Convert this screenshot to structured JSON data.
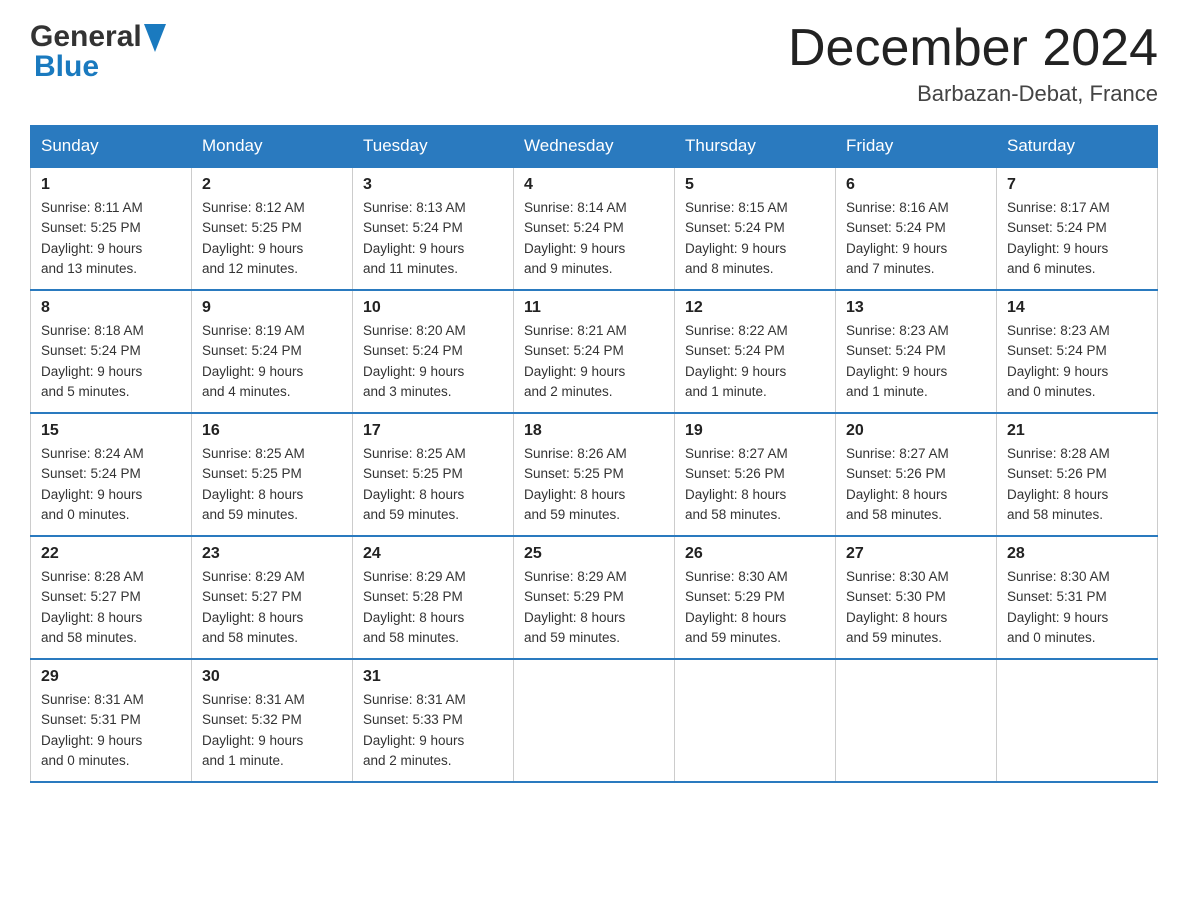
{
  "header": {
    "logo_general": "General",
    "logo_blue": "Blue",
    "month_title": "December 2024",
    "location": "Barbazan-Debat, France"
  },
  "days_of_week": [
    "Sunday",
    "Monday",
    "Tuesday",
    "Wednesday",
    "Thursday",
    "Friday",
    "Saturday"
  ],
  "weeks": [
    [
      {
        "day": "1",
        "sunrise": "Sunrise: 8:11 AM",
        "sunset": "Sunset: 5:25 PM",
        "daylight": "Daylight: 9 hours and 13 minutes."
      },
      {
        "day": "2",
        "sunrise": "Sunrise: 8:12 AM",
        "sunset": "Sunset: 5:25 PM",
        "daylight": "Daylight: 9 hours and 12 minutes."
      },
      {
        "day": "3",
        "sunrise": "Sunrise: 8:13 AM",
        "sunset": "Sunset: 5:24 PM",
        "daylight": "Daylight: 9 hours and 11 minutes."
      },
      {
        "day": "4",
        "sunrise": "Sunrise: 8:14 AM",
        "sunset": "Sunset: 5:24 PM",
        "daylight": "Daylight: 9 hours and 9 minutes."
      },
      {
        "day": "5",
        "sunrise": "Sunrise: 8:15 AM",
        "sunset": "Sunset: 5:24 PM",
        "daylight": "Daylight: 9 hours and 8 minutes."
      },
      {
        "day": "6",
        "sunrise": "Sunrise: 8:16 AM",
        "sunset": "Sunset: 5:24 PM",
        "daylight": "Daylight: 9 hours and 7 minutes."
      },
      {
        "day": "7",
        "sunrise": "Sunrise: 8:17 AM",
        "sunset": "Sunset: 5:24 PM",
        "daylight": "Daylight: 9 hours and 6 minutes."
      }
    ],
    [
      {
        "day": "8",
        "sunrise": "Sunrise: 8:18 AM",
        "sunset": "Sunset: 5:24 PM",
        "daylight": "Daylight: 9 hours and 5 minutes."
      },
      {
        "day": "9",
        "sunrise": "Sunrise: 8:19 AM",
        "sunset": "Sunset: 5:24 PM",
        "daylight": "Daylight: 9 hours and 4 minutes."
      },
      {
        "day": "10",
        "sunrise": "Sunrise: 8:20 AM",
        "sunset": "Sunset: 5:24 PM",
        "daylight": "Daylight: 9 hours and 3 minutes."
      },
      {
        "day": "11",
        "sunrise": "Sunrise: 8:21 AM",
        "sunset": "Sunset: 5:24 PM",
        "daylight": "Daylight: 9 hours and 2 minutes."
      },
      {
        "day": "12",
        "sunrise": "Sunrise: 8:22 AM",
        "sunset": "Sunset: 5:24 PM",
        "daylight": "Daylight: 9 hours and 1 minute."
      },
      {
        "day": "13",
        "sunrise": "Sunrise: 8:23 AM",
        "sunset": "Sunset: 5:24 PM",
        "daylight": "Daylight: 9 hours and 1 minute."
      },
      {
        "day": "14",
        "sunrise": "Sunrise: 8:23 AM",
        "sunset": "Sunset: 5:24 PM",
        "daylight": "Daylight: 9 hours and 0 minutes."
      }
    ],
    [
      {
        "day": "15",
        "sunrise": "Sunrise: 8:24 AM",
        "sunset": "Sunset: 5:24 PM",
        "daylight": "Daylight: 9 hours and 0 minutes."
      },
      {
        "day": "16",
        "sunrise": "Sunrise: 8:25 AM",
        "sunset": "Sunset: 5:25 PM",
        "daylight": "Daylight: 8 hours and 59 minutes."
      },
      {
        "day": "17",
        "sunrise": "Sunrise: 8:25 AM",
        "sunset": "Sunset: 5:25 PM",
        "daylight": "Daylight: 8 hours and 59 minutes."
      },
      {
        "day": "18",
        "sunrise": "Sunrise: 8:26 AM",
        "sunset": "Sunset: 5:25 PM",
        "daylight": "Daylight: 8 hours and 59 minutes."
      },
      {
        "day": "19",
        "sunrise": "Sunrise: 8:27 AM",
        "sunset": "Sunset: 5:26 PM",
        "daylight": "Daylight: 8 hours and 58 minutes."
      },
      {
        "day": "20",
        "sunrise": "Sunrise: 8:27 AM",
        "sunset": "Sunset: 5:26 PM",
        "daylight": "Daylight: 8 hours and 58 minutes."
      },
      {
        "day": "21",
        "sunrise": "Sunrise: 8:28 AM",
        "sunset": "Sunset: 5:26 PM",
        "daylight": "Daylight: 8 hours and 58 minutes."
      }
    ],
    [
      {
        "day": "22",
        "sunrise": "Sunrise: 8:28 AM",
        "sunset": "Sunset: 5:27 PM",
        "daylight": "Daylight: 8 hours and 58 minutes."
      },
      {
        "day": "23",
        "sunrise": "Sunrise: 8:29 AM",
        "sunset": "Sunset: 5:27 PM",
        "daylight": "Daylight: 8 hours and 58 minutes."
      },
      {
        "day": "24",
        "sunrise": "Sunrise: 8:29 AM",
        "sunset": "Sunset: 5:28 PM",
        "daylight": "Daylight: 8 hours and 58 minutes."
      },
      {
        "day": "25",
        "sunrise": "Sunrise: 8:29 AM",
        "sunset": "Sunset: 5:29 PM",
        "daylight": "Daylight: 8 hours and 59 minutes."
      },
      {
        "day": "26",
        "sunrise": "Sunrise: 8:30 AM",
        "sunset": "Sunset: 5:29 PM",
        "daylight": "Daylight: 8 hours and 59 minutes."
      },
      {
        "day": "27",
        "sunrise": "Sunrise: 8:30 AM",
        "sunset": "Sunset: 5:30 PM",
        "daylight": "Daylight: 8 hours and 59 minutes."
      },
      {
        "day": "28",
        "sunrise": "Sunrise: 8:30 AM",
        "sunset": "Sunset: 5:31 PM",
        "daylight": "Daylight: 9 hours and 0 minutes."
      }
    ],
    [
      {
        "day": "29",
        "sunrise": "Sunrise: 8:31 AM",
        "sunset": "Sunset: 5:31 PM",
        "daylight": "Daylight: 9 hours and 0 minutes."
      },
      {
        "day": "30",
        "sunrise": "Sunrise: 8:31 AM",
        "sunset": "Sunset: 5:32 PM",
        "daylight": "Daylight: 9 hours and 1 minute."
      },
      {
        "day": "31",
        "sunrise": "Sunrise: 8:31 AM",
        "sunset": "Sunset: 5:33 PM",
        "daylight": "Daylight: 9 hours and 2 minutes."
      },
      null,
      null,
      null,
      null
    ]
  ]
}
